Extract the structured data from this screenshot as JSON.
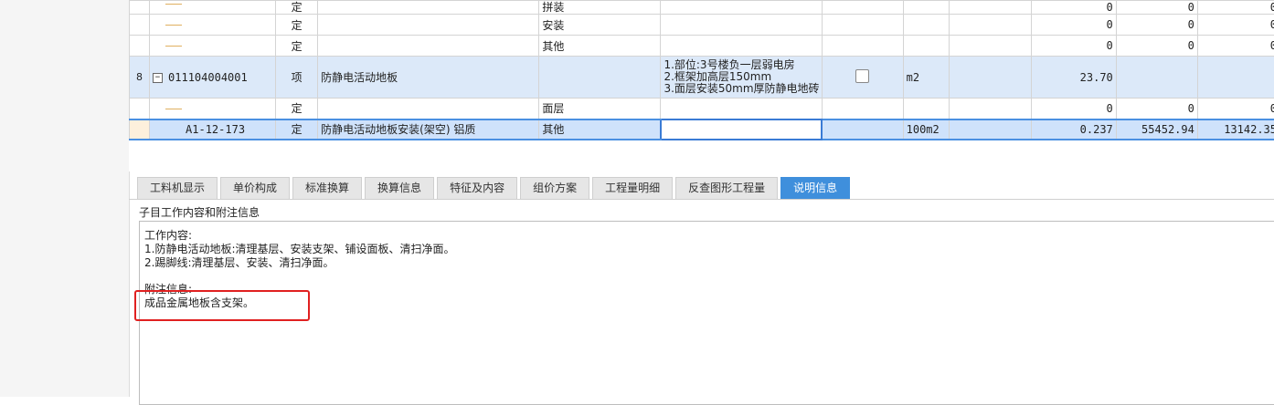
{
  "grid": {
    "rows": [
      {
        "type": "定",
        "name": "",
        "feature": "拼装",
        "qty": "0",
        "price": "0",
        "total": "0"
      },
      {
        "type": "定",
        "name": "",
        "feature": "安装",
        "qty": "0",
        "price": "0",
        "total": "0"
      },
      {
        "type": "定",
        "name": "",
        "feature": "其他",
        "qty": "0",
        "price": "0",
        "total": "0"
      },
      {
        "index": "8",
        "code": "011104004001",
        "type": "项",
        "name": "防静电活动地板",
        "desc": [
          "1.部位:3号楼负一层弱电房",
          "2.框架加高层150mm",
          "3.面层安装50mm厚防静电地砖"
        ],
        "unit": "m2",
        "qty": "23.70"
      },
      {
        "type": "定",
        "name": "",
        "feature": "面层",
        "qty": "0",
        "price": "0",
        "total": "0"
      },
      {
        "code": "A1-12-173",
        "type": "定",
        "name": "防静电活动地板安装(架空) 铝质",
        "feature": "其他",
        "unit": "100m2",
        "qty": "0.237",
        "price": "55452.94",
        "total": "13142.35"
      }
    ]
  },
  "tabs": [
    "工料机显示",
    "单价构成",
    "标准换算",
    "换算信息",
    "特征及内容",
    "组价方案",
    "工程量明细",
    "反查图形工程量",
    "说明信息"
  ],
  "active_tab": "说明信息",
  "section_title": "子目工作内容和附注信息",
  "notes": {
    "work_header": "工作内容:",
    "work_1": "1.防静电活动地板:清理基层、安装支架、铺设面板、清扫净面。",
    "work_2": "2.踢脚线:清理基层、安装、清扫净面。",
    "attach_header": "附注信息:",
    "attach_1": "成品金属地板含支架。"
  },
  "colors": {
    "accent": "#3f8fdc",
    "highlight_row": "#dce9f9",
    "annotation": "#e02020"
  }
}
